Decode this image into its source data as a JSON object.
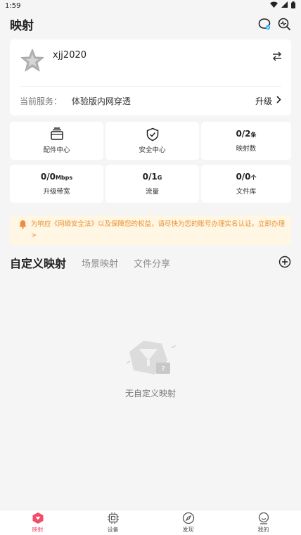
{
  "status_bar": {
    "time": "1:59"
  },
  "app": {
    "title": "映射"
  },
  "profile": {
    "username": "xjj2020",
    "service_label": "当前服务：",
    "service_value": "体验版内网穿透",
    "upgrade_label": "升级"
  },
  "tiles": [
    {
      "type": "icon",
      "icon": "accessories-box-icon",
      "label": "配件中心"
    },
    {
      "type": "icon",
      "icon": "shield-check-icon",
      "label": "安全中心"
    },
    {
      "type": "stat",
      "value": "0/2",
      "unit": "条",
      "label": "映射数"
    },
    {
      "type": "stat",
      "value": "0/0",
      "unit": "Mbps",
      "label": "升级带宽"
    },
    {
      "type": "stat",
      "value": "0/1",
      "unit": "G",
      "label": "流量"
    },
    {
      "type": "stat",
      "value": "0/0",
      "unit": "个",
      "label": "文件库"
    }
  ],
  "notice": {
    "text": "为响应《网络安全法》以及保障您的权益，请尽快为您的账号办理实名认证。立即办理>"
  },
  "tabs": [
    {
      "label": "自定义映射",
      "active": true
    },
    {
      "label": "场景映射",
      "active": false
    },
    {
      "label": "文件分享",
      "active": false
    }
  ],
  "empty_state": {
    "text": "无自定义映射"
  },
  "bottom_nav": [
    {
      "label": "映射",
      "icon": "mapping-icon",
      "active": true
    },
    {
      "label": "设备",
      "icon": "device-icon",
      "active": false
    },
    {
      "label": "发现",
      "icon": "compass-icon",
      "active": false
    },
    {
      "label": "我的",
      "icon": "profile-icon",
      "active": false
    }
  ],
  "colors": {
    "accent": "#f14d6b",
    "notice_text": "#e8912f",
    "notice_bg": "#fff6e4",
    "background": "#f5f5f5"
  }
}
